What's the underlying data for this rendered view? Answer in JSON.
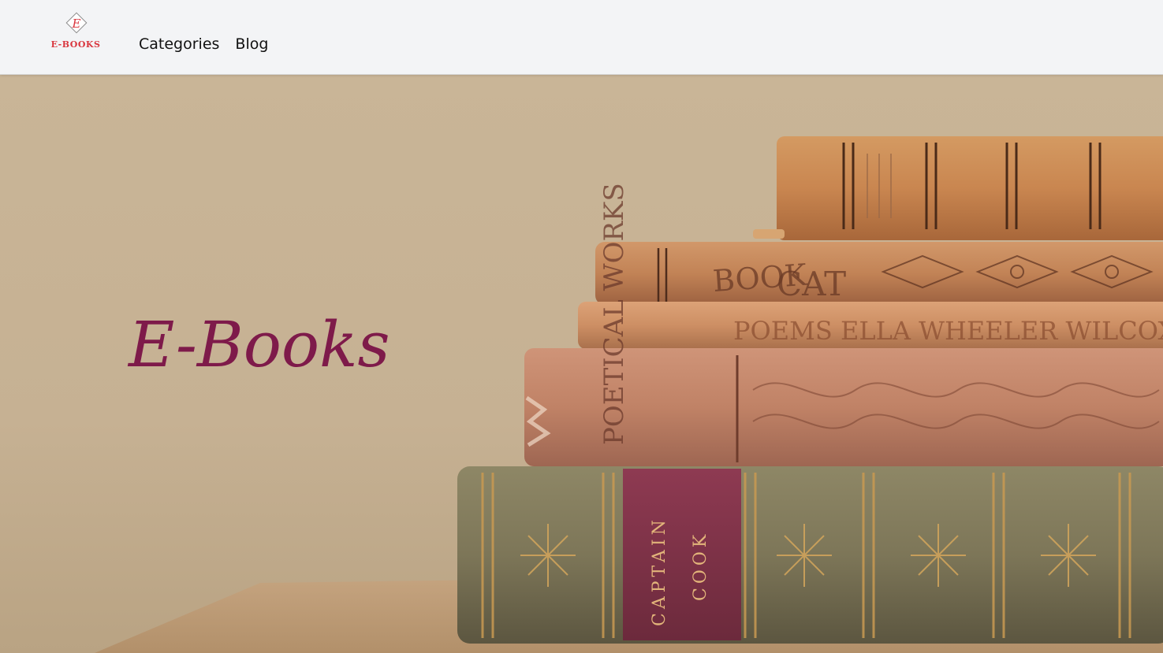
{
  "header": {
    "logo": {
      "letter": "E",
      "text": "E-BOOKS"
    },
    "nav": [
      {
        "label": "Categories"
      },
      {
        "label": "Blog"
      }
    ]
  },
  "hero": {
    "title": "E-Books",
    "image_semantic": "stack-of-antique-books",
    "book_spines": [
      {
        "text": "POEMS ELLA WHEELER WILCOX"
      },
      {
        "text": "POETICAL WORKS"
      },
      {
        "text": "CAPTAIN"
      },
      {
        "text": "COOK"
      }
    ]
  },
  "colors": {
    "navbar_bg": "#f3f4f6",
    "logo_red": "#d9363e",
    "hero_title": "#7e1a4a",
    "hero_bg": "#c8b496"
  }
}
